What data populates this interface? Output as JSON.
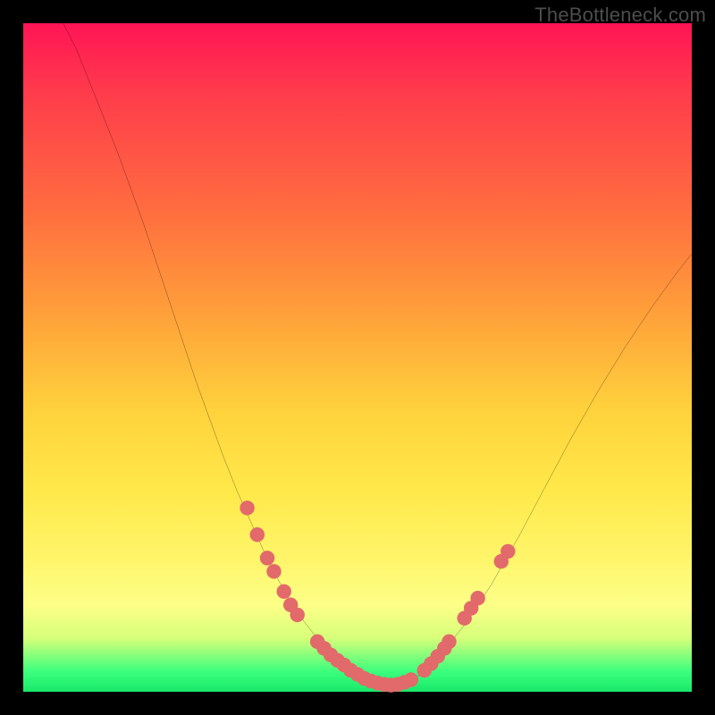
{
  "watermark": "TheBottleneck.com",
  "colors": {
    "frame": "#000000",
    "curve": "#000000",
    "marker": "#e26a6a",
    "gradient_stops": [
      "#ff1455",
      "#ff3a4c",
      "#ff6d3f",
      "#ffa23a",
      "#ffd23c",
      "#ffe94a",
      "#fff56a",
      "#fdff87",
      "#d6ff7a",
      "#3bff7d",
      "#19e86a"
    ]
  },
  "chart_data": {
    "type": "line",
    "title": "",
    "xlabel": "",
    "ylabel": "",
    "xlim": [
      0,
      100
    ],
    "ylim": [
      0,
      100
    ],
    "grid": false,
    "series": [
      {
        "name": "bottleneck-curve",
        "x": [
          6,
          8,
          10,
          12,
          14,
          16,
          18,
          20,
          22,
          24,
          26,
          28,
          30,
          32,
          34,
          36,
          38,
          40,
          42,
          44,
          46,
          48,
          50,
          52,
          54,
          56,
          58,
          60,
          62,
          66,
          70,
          74,
          78,
          82,
          86,
          90,
          94,
          98,
          100
        ],
        "y": [
          100,
          96,
          91,
          86,
          81,
          75.5,
          70,
          64,
          58,
          52,
          46,
          40.5,
          35,
          30,
          25.5,
          21,
          17,
          13.5,
          10.5,
          8,
          5.8,
          4,
          2.6,
          1.6,
          1,
          1,
          1.6,
          3,
          5,
          10,
          16,
          23,
          30.5,
          38,
          45,
          51.5,
          57.5,
          63,
          65.5
        ]
      }
    ],
    "markers": [
      {
        "x": 33.5,
        "y": 27.5
      },
      {
        "x": 35,
        "y": 23.5
      },
      {
        "x": 36.5,
        "y": 20
      },
      {
        "x": 37.5,
        "y": 18
      },
      {
        "x": 39,
        "y": 15
      },
      {
        "x": 40,
        "y": 13
      },
      {
        "x": 41,
        "y": 11.5
      },
      {
        "x": 44,
        "y": 7.5
      },
      {
        "x": 45,
        "y": 6.5
      },
      {
        "x": 46,
        "y": 5.5
      },
      {
        "x": 47,
        "y": 4.7
      },
      {
        "x": 48,
        "y": 4
      },
      {
        "x": 49,
        "y": 3.2
      },
      {
        "x": 50,
        "y": 2.6
      },
      {
        "x": 51,
        "y": 2
      },
      {
        "x": 52,
        "y": 1.6
      },
      {
        "x": 53,
        "y": 1.3
      },
      {
        "x": 54,
        "y": 1.1
      },
      {
        "x": 55,
        "y": 1
      },
      {
        "x": 56,
        "y": 1.1
      },
      {
        "x": 57,
        "y": 1.4
      },
      {
        "x": 58,
        "y": 1.8
      },
      {
        "x": 60,
        "y": 3.2
      },
      {
        "x": 61,
        "y": 4.2
      },
      {
        "x": 62,
        "y": 5.3
      },
      {
        "x": 63,
        "y": 6.5
      },
      {
        "x": 63.7,
        "y": 7.5
      },
      {
        "x": 66,
        "y": 11
      },
      {
        "x": 67,
        "y": 12.5
      },
      {
        "x": 68,
        "y": 14
      },
      {
        "x": 71.5,
        "y": 19.5
      },
      {
        "x": 72.5,
        "y": 21
      }
    ],
    "marker_color": "#e26a6a",
    "marker_radius": 1.1
  }
}
